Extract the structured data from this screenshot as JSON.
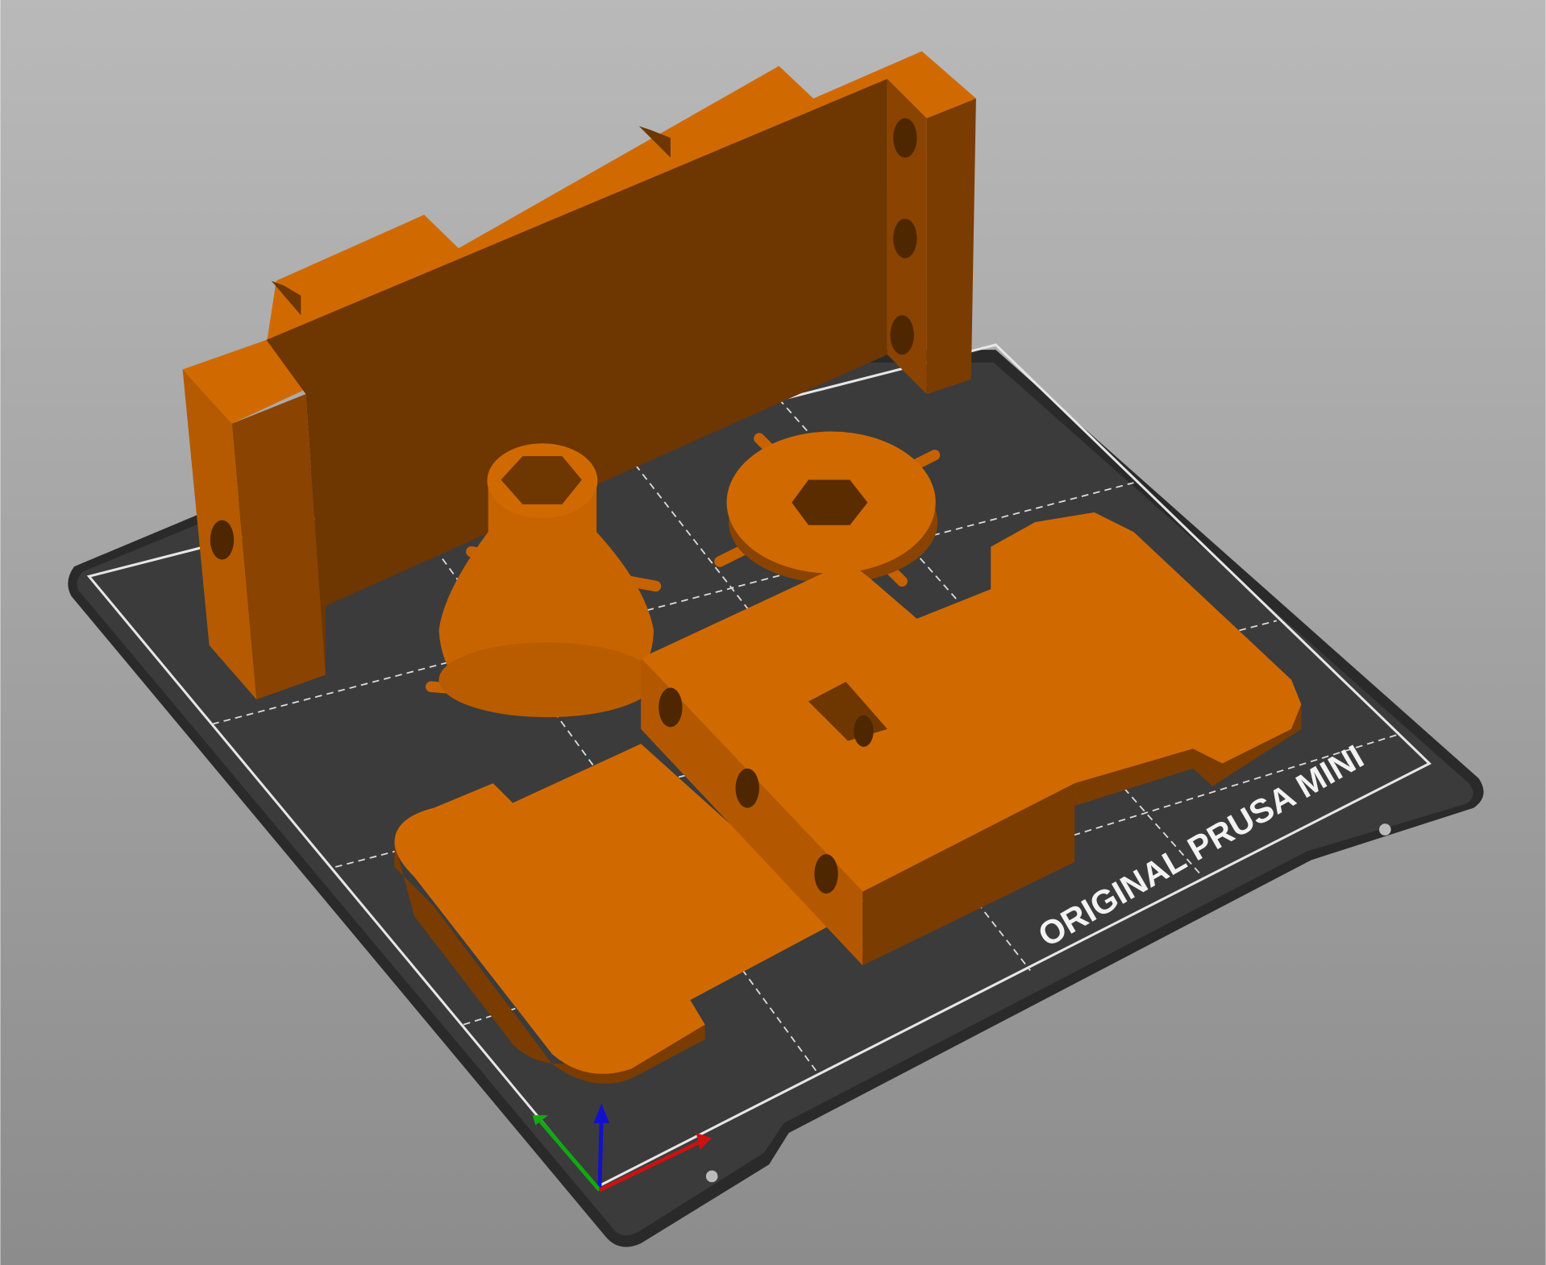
{
  "viewport": {
    "bed_label": "ORIGINAL PRUSA MINI",
    "object_color": "#CC6600",
    "bed_color": "#3B3B3B",
    "background_top": "#B9B9B9",
    "background_bottom": "#8C8C8C",
    "axes": {
      "x_color": "#CC1111",
      "y_color": "#11AA11",
      "z_color": "#1111CC"
    }
  }
}
